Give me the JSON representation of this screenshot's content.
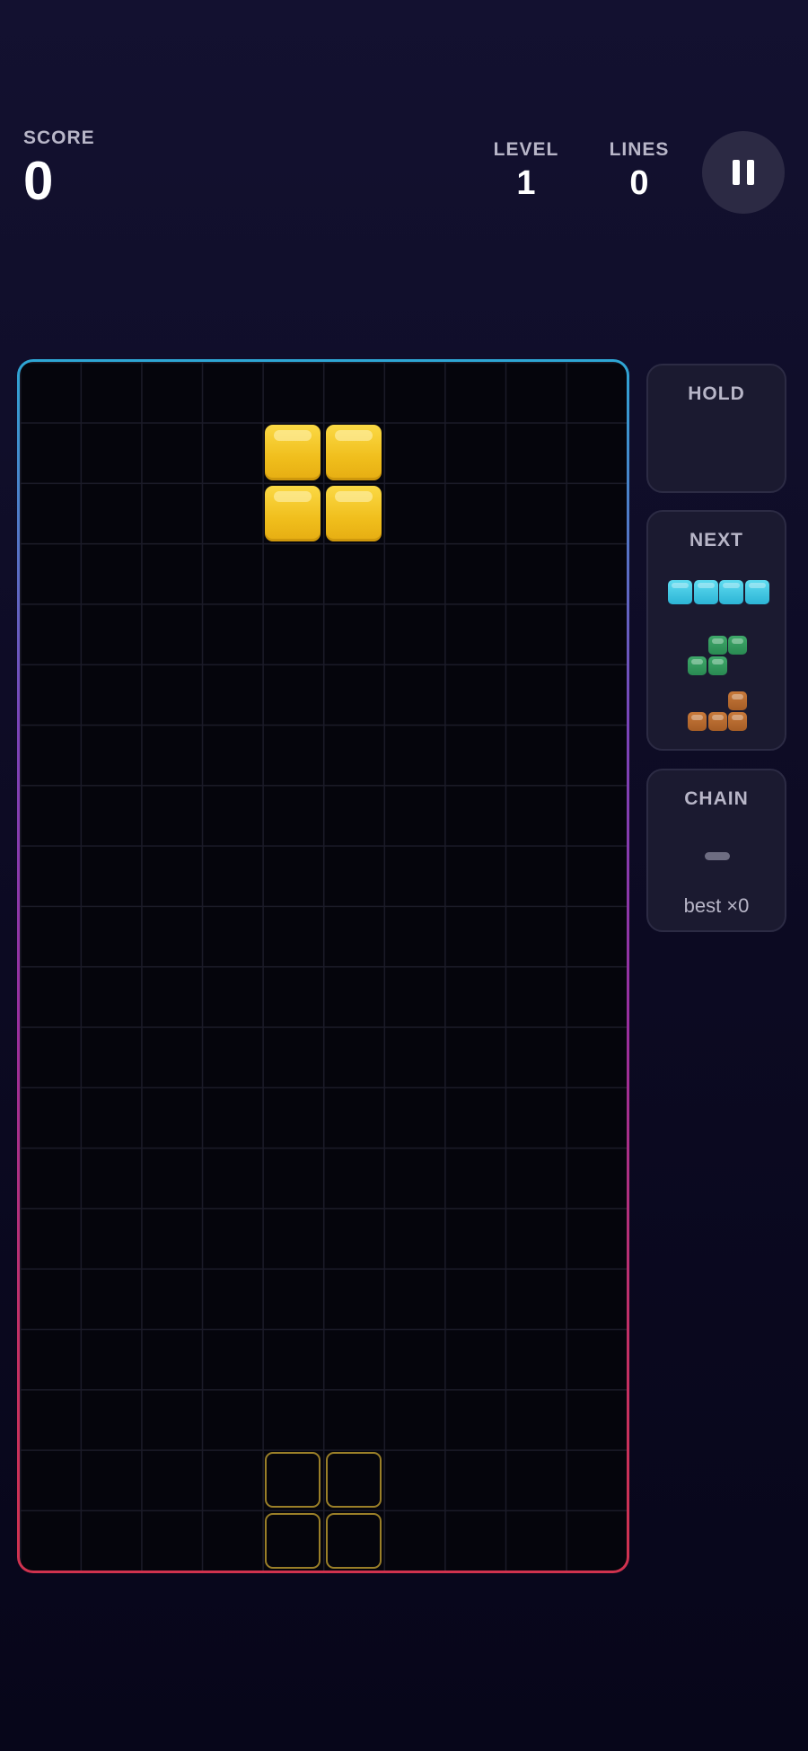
{
  "header": {
    "score_label": "SCORE",
    "score_value": "0",
    "level_label": "LEVEL",
    "level_value": "1",
    "lines_label": "LINES",
    "lines_value": "0",
    "pause_icon": "pause-icon"
  },
  "board": {
    "columns": 10,
    "rows": 20,
    "active_piece": {
      "type": "O",
      "color": "#f5c727",
      "cells": [
        [
          4,
          1
        ],
        [
          5,
          1
        ],
        [
          4,
          2
        ],
        [
          5,
          2
        ]
      ]
    },
    "ghost_piece": {
      "color": "#9a7f28",
      "cells": [
        [
          4,
          18
        ],
        [
          5,
          18
        ],
        [
          4,
          19
        ],
        [
          5,
          19
        ]
      ]
    },
    "frame_gradient": [
      "#2ea6d4",
      "#9a2f9e",
      "#d0324e"
    ]
  },
  "hold": {
    "title": "HOLD",
    "piece": null
  },
  "next": {
    "title": "NEXT",
    "pieces": [
      {
        "type": "I",
        "color": "#3ec8e4"
      },
      {
        "type": "S",
        "color": "#34995e"
      },
      {
        "type": "L",
        "color": "#b86b30"
      }
    ]
  },
  "chain": {
    "title": "CHAIN",
    "current": "–",
    "best": "best ×0"
  }
}
